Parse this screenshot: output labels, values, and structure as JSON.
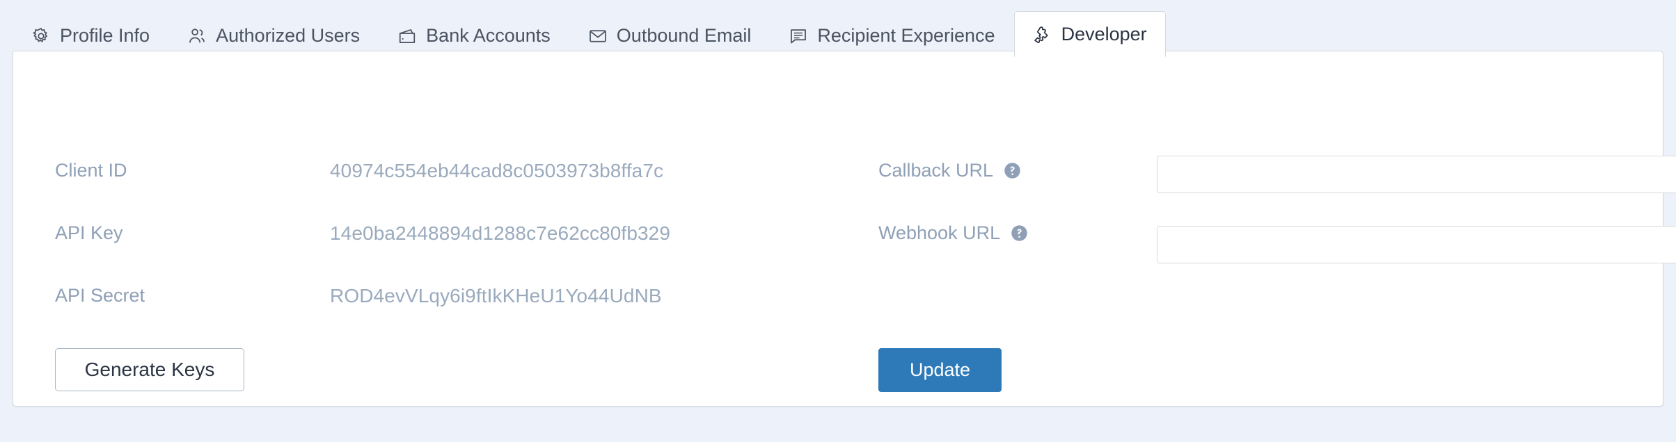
{
  "colors": {
    "page_background": "#edf1f9",
    "panel_background": "#ffffff",
    "panel_border": "#d3d9e0",
    "label_text": "#8fa0b6",
    "value_text": "#9aaabd",
    "tab_text": "#4a5361",
    "active_tab_text": "#2b3442",
    "primary_button": "#2e7ab8",
    "secondary_button_border": "#a7b6c6",
    "input_border": "#d8dadd"
  },
  "tabs": [
    {
      "label": "Profile Info",
      "icon": "gear-icon",
      "active": false
    },
    {
      "label": "Authorized Users",
      "icon": "users-icon",
      "active": false
    },
    {
      "label": "Bank Accounts",
      "icon": "wallet-icon",
      "active": false
    },
    {
      "label": "Outbound Email",
      "icon": "envelope-icon",
      "active": false
    },
    {
      "label": "Recipient Experience",
      "icon": "chat-bubble-icon",
      "active": false
    },
    {
      "label": "Developer",
      "icon": "puzzle-piece-icon",
      "active": true
    }
  ],
  "credentials": [
    {
      "label": "Client ID",
      "value": "40974c554eb44cad8c0503973b8ffa7c"
    },
    {
      "label": "API Key",
      "value": "14e0ba2448894d1288c7e62cc80fb329"
    },
    {
      "label": "API Secret",
      "value": "ROD4evVLqy6i9ftIkKHeU1Yo44UdNB"
    }
  ],
  "url_fields": [
    {
      "label": "Callback URL",
      "value": "",
      "placeholder": "",
      "help": "help-icon"
    },
    {
      "label": "Webhook URL",
      "value": "",
      "placeholder": "",
      "help": "help-icon"
    }
  ],
  "buttons": {
    "generate_keys": "Generate Keys",
    "update": "Update"
  }
}
